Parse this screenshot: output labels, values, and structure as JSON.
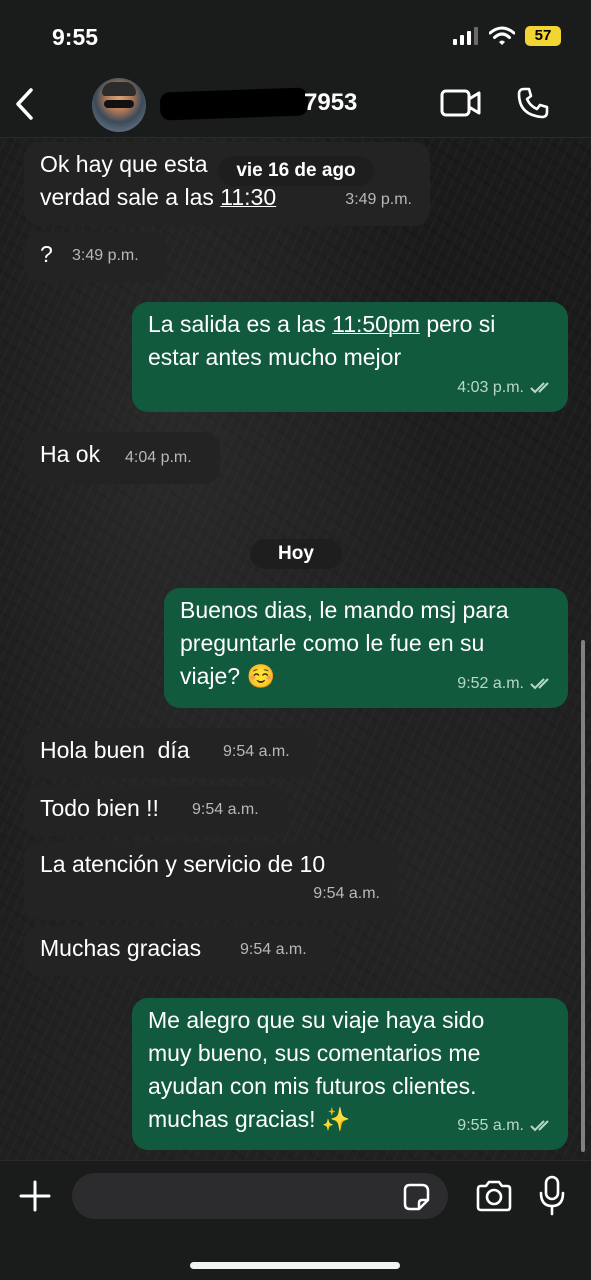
{
  "status_bar": {
    "time": "9:55",
    "battery": "57"
  },
  "header": {
    "contact_name": "7953"
  },
  "date_dividers": {
    "previous": "vie 16 de ago",
    "today": "Hoy"
  },
  "messages": [
    {
      "direction": "in",
      "text": "Ok hay que esta",
      "text_cont": "s",
      "text_line2_a": "verdad sale a las ",
      "text_line2_link": "11:30",
      "time": "3:49 p.m."
    },
    {
      "direction": "in",
      "text": "?",
      "time": "3:49 p.m."
    },
    {
      "direction": "out",
      "line1_a": "La salida es a las ",
      "line1_link": "11:50pm",
      "line1_b": " pero si",
      "line2": "estar antes mucho mejor",
      "time": "4:03 p.m."
    },
    {
      "direction": "in",
      "text": "Ha ok",
      "time": "4:04 p.m."
    },
    {
      "direction": "out",
      "line1": "Buenos dias, le mando msj para",
      "line2": "preguntarle como le fue en su",
      "line3": "viaje? ☺️",
      "time": "9:52 a.m."
    },
    {
      "direction": "in",
      "text": "Hola buen  día",
      "time": "9:54 a.m."
    },
    {
      "direction": "in",
      "text": "Todo bien !!",
      "time": "9:54 a.m."
    },
    {
      "direction": "in",
      "text": "La atención y servicio de 10",
      "time": "9:54 a.m."
    },
    {
      "direction": "in",
      "text": "Muchas gracias",
      "time": "9:54 a.m."
    },
    {
      "direction": "out",
      "line1": "Me alegro que su viaje haya sido",
      "line2": "muy bueno, sus comentarios me",
      "line3": "ayudan con mis futuros clientes.",
      "line4": "muchas gracias! ✨",
      "time": "9:55 a.m."
    }
  ],
  "composer": {
    "placeholder": ""
  },
  "icons": {
    "back": "chevron-left",
    "video": "video-camera",
    "call": "phone",
    "plus": "plus",
    "sticker": "sticker",
    "camera": "camera",
    "mic": "microphone",
    "read_receipt": "double-check"
  },
  "colors": {
    "outgoing_bubble": "#115a3d",
    "incoming_bubble": "#232323",
    "battery": "#f2d533"
  }
}
